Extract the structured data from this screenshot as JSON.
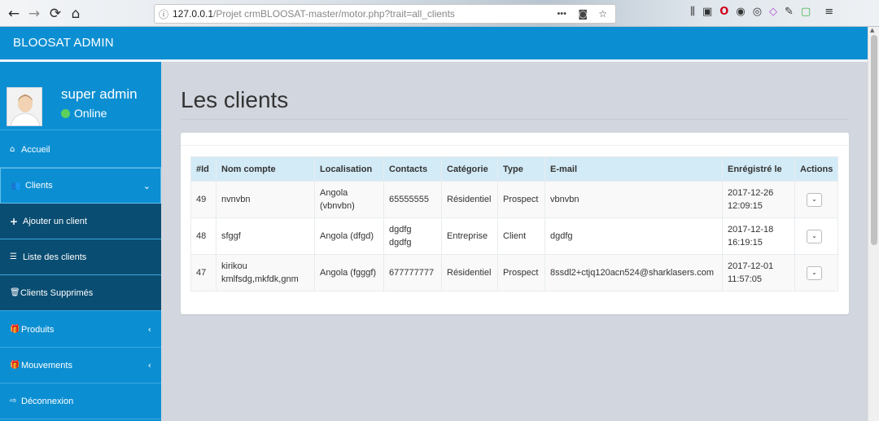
{
  "browser": {
    "back_icon": "←",
    "forward_icon": "→",
    "reload_icon": "⟳",
    "home_icon": "⌂",
    "url_info_icon": "ⓘ",
    "url_host": "127.0.0.1",
    "url_path": "/Projet crmBLOOSAT-master/motor.php?trait=all_clients",
    "page_actions": "•••",
    "toolbar_icons": [
      "⫼",
      "▣",
      "O",
      "◉",
      "◎",
      "◇",
      "✎",
      "▢",
      "≡"
    ]
  },
  "app": {
    "brand": "BLOOSAT ADMIN"
  },
  "user": {
    "name": "super admin",
    "status": "Online"
  },
  "sidebar": {
    "items": [
      {
        "icon": "⌂",
        "label": "Accueil"
      },
      {
        "icon": "👥",
        "label": "Clients",
        "arrow": "⌄"
      },
      {
        "icon": "+",
        "label": "Ajouter un client"
      },
      {
        "icon": "☰",
        "label": "Liste des clients"
      },
      {
        "icon": "🗑",
        "label": "Clients Supprimés"
      },
      {
        "icon": "🎁",
        "label": "Produits",
        "arrow": "‹"
      },
      {
        "icon": "🎁",
        "label": "Mouvements",
        "arrow": "‹"
      },
      {
        "icon": "⇨",
        "label": "Déconnexion"
      }
    ]
  },
  "main": {
    "title": "Les clients"
  },
  "table": {
    "headers": [
      "#Id",
      "Nom compte",
      "Localisation",
      "Contacts",
      "Catégorie",
      "Type",
      "E-mail",
      "Enrégistré le",
      "Actions"
    ],
    "rows": [
      {
        "id": "49",
        "nom": "nvnvbn",
        "localisation": "Angola (vbnvbn)",
        "contacts": "65555555",
        "categorie": "Résidentiel",
        "type": "Prospect",
        "email": "vbnvbn",
        "date": "2017-12-26 12:09:15"
      },
      {
        "id": "48",
        "nom": "sfggf",
        "localisation": "Angola (dfgd)",
        "contacts": "dgdfg dgdfg",
        "categorie": "Entreprise",
        "type": "Client",
        "email": "dgdfg",
        "date": "2017-12-18 16:19:15"
      },
      {
        "id": "47",
        "nom": "kirikou kmlfsdg,mkfdk,gnm",
        "localisation": "Angola (fgggf)",
        "contacts": "677777777",
        "categorie": "Résidentiel",
        "type": "Prospect",
        "email": "8ssdl2+ctjq120acn524@sharklasers.com",
        "date": "2017-12-01 11:57:05"
      }
    ],
    "action_icon": "⌄"
  }
}
